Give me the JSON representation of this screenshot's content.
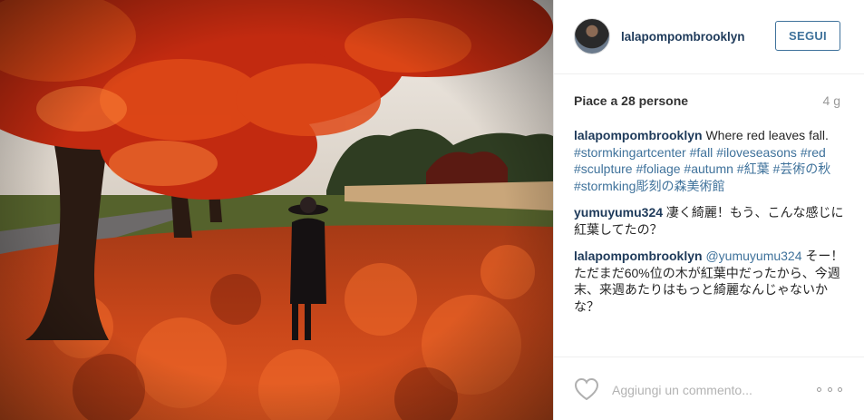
{
  "post": {
    "photo_alt": "",
    "username": "lalapompombrooklyn",
    "follow_label": "SEGUI",
    "likes": "Piace a 28 persone",
    "timestamp": "4 g",
    "caption": {
      "user": "lalapompombrooklyn",
      "text": " Where red leaves fall. ",
      "hashtags": [
        "#stormkingartcenter",
        "#fall",
        "#iloveseasons",
        "#red",
        "#sculpture",
        "#foliage",
        "#autumn",
        "#紅葉",
        "#芸術の秋",
        "#stormking彫刻の森美術館"
      ]
    },
    "comments": [
      {
        "user": "yumuyumu324",
        "mention": "",
        "text": " 凄く綺麗！もう、こんな感じに紅葉してたの？"
      },
      {
        "user": "lalapompombrooklyn",
        "mention": " @yumuyumu324",
        "text": " そー！ただまだ60%位の木が紅葉中だったから、今週末、来週あたりはもっと綺麗なんじゃないかな？"
      }
    ],
    "comment_placeholder": "Aggiungi un commento...",
    "icons": {
      "like": "heart-icon",
      "more": "more-options-icon"
    },
    "colors": {
      "username": "#1e3a5a",
      "hashtag": "#3f729b",
      "follow": "#3f729b"
    }
  }
}
